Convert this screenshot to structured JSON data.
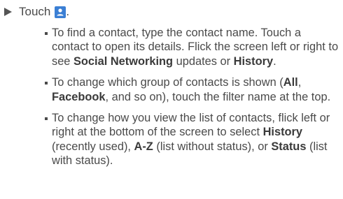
{
  "step": {
    "text": "Touch",
    "suffix": ".",
    "icon": "contacts-icon",
    "icon_color": "#3b7fd4"
  },
  "bullets": [
    {
      "t1": "To find a contact, type the contact name. Touch a contact to open its details. Flick the screen left or right to see ",
      "b1": "Social Networking",
      "t2": " updates or ",
      "b2": "History",
      "t3": "."
    },
    {
      "t1": "To change which group of contacts is shown (",
      "b1": "All",
      "t2": ", ",
      "b2": "Facebook",
      "t3": ", and so on), touch the filter name at the top."
    },
    {
      "t1": "To change how you view the list of contacts, flick left or right at the bottom of the screen to select ",
      "b1": "History",
      "t2": " (recently used), ",
      "b2": "A-Z",
      "t3": " (list without status), or ",
      "b3": "Status",
      "t4": " (list with status)."
    }
  ]
}
